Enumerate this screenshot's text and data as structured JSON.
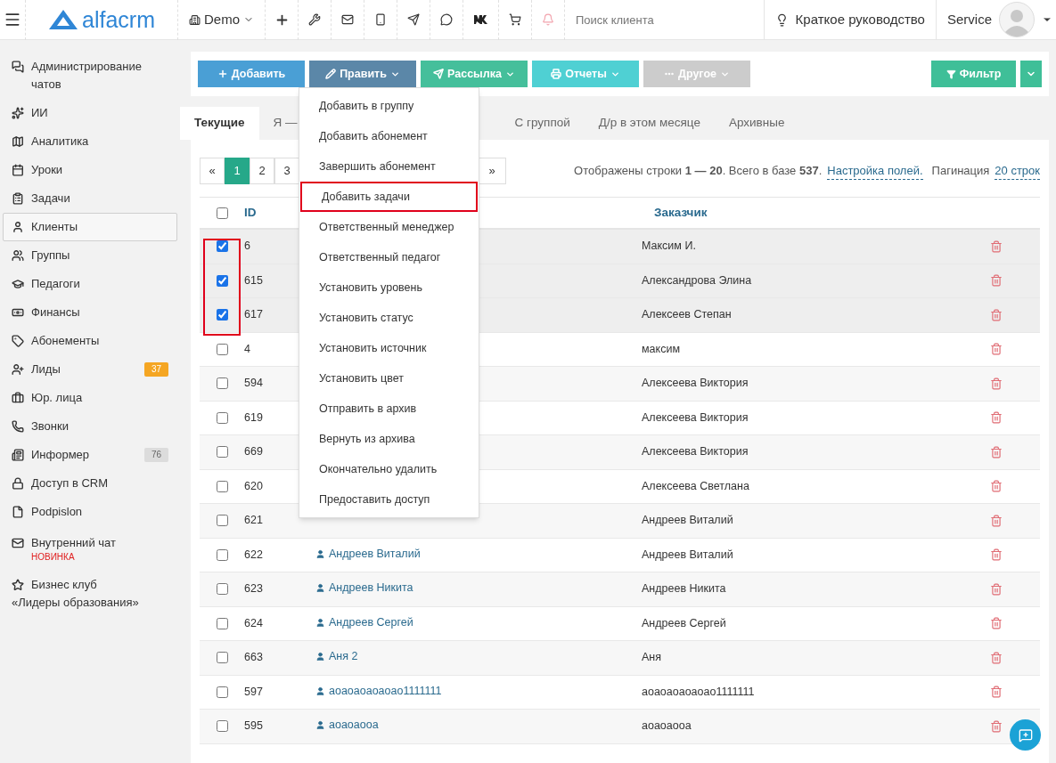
{
  "topbar": {
    "logo": "alfacrm",
    "branch": "Demo",
    "search": {
      "placeholder": "Поиск клиента"
    },
    "guide": "Краткое руководство",
    "user": "Service"
  },
  "sidebar": {
    "items": [
      {
        "label": "Администрирование чатов",
        "selected": false
      },
      {
        "label": "ИИ",
        "selected": false
      },
      {
        "label": "Аналитика",
        "selected": false
      },
      {
        "label": "Уроки",
        "selected": false
      },
      {
        "label": "Задачи",
        "selected": false
      },
      {
        "label": "Клиенты",
        "selected": true
      },
      {
        "label": "Группы",
        "selected": false
      },
      {
        "label": "Педагоги",
        "selected": false
      },
      {
        "label": "Финансы",
        "selected": false
      },
      {
        "label": "Абонементы",
        "selected": false
      },
      {
        "label": "Лиды",
        "selected": false,
        "badge": {
          "text": "37",
          "color": "#f5a623"
        }
      },
      {
        "label": "Юр. лица",
        "selected": false
      },
      {
        "label": "Звонки",
        "selected": false
      },
      {
        "label": "Информер",
        "selected": false,
        "badge": {
          "text": "76",
          "color": "#dcdcdc"
        }
      },
      {
        "label": "Доступ в CRM",
        "selected": false
      },
      {
        "label": "Podpislon",
        "selected": false
      },
      {
        "label": "Внутренний чат",
        "selected": false,
        "note": "НОВИНКА"
      },
      {
        "label": "Бизнес клуб",
        "label_2": "«Лидеры образования»",
        "selected": false
      }
    ]
  },
  "toolbar": {
    "buttons": [
      {
        "label": "Добавить",
        "color": "#4a9fd5"
      },
      {
        "label": "Править",
        "color": "#5b87a8"
      },
      {
        "label": "Рассылка",
        "color": "#45bf9b"
      },
      {
        "label": "Отчеты",
        "color": "#4fd0d3"
      },
      {
        "label": "Другое",
        "color": "#cccccc"
      }
    ],
    "filter": "Фильтр"
  },
  "tabs": [
    {
      "label": "Текущие",
      "selected": true
    },
    {
      "label": "Я —",
      "selected": false
    },
    {
      "label": "С группой",
      "selected": false
    },
    {
      "label": "Д/р в этом месяце",
      "selected": false
    },
    {
      "label": "Архивные",
      "selected": false
    }
  ],
  "pagination": {
    "pages": [
      {
        "label": "«",
        "selected": false
      },
      {
        "label": "1",
        "selected": true
      },
      {
        "label": "2",
        "selected": false
      },
      {
        "label": "3",
        "selected": false
      }
    ],
    "next": "»"
  },
  "summary": {
    "info": "Отображены строки **1 — 20**. Всего в базе **537**.",
    "fields_link": "Настройка полей.",
    "page_size_label": "Пагинация",
    "page_size_link": "20 строк"
  },
  "table": {
    "all_selected": false,
    "columns": [
      "ID",
      "Заказчик"
    ],
    "rows": [
      {
        "id": "6",
        "customer": "Максим И.",
        "selected": true
      },
      {
        "id": "615",
        "customer": "Александрова Элина",
        "selected": true
      },
      {
        "id": "617",
        "customer": "Алексеев Степан",
        "selected": true
      },
      {
        "id": "4",
        "customer": "максим",
        "selected": false
      },
      {
        "id": "594",
        "customer": "Алексеева Виктория",
        "selected": false
      },
      {
        "id": "619",
        "customer": "Алексеева Виктория",
        "selected": false
      },
      {
        "id": "669",
        "customer": "Алексеева Виктория",
        "selected": false
      },
      {
        "id": "620",
        "customer": "Алексеева Светлана",
        "selected": false
      },
      {
        "id": "621",
        "customer": "Андреев Виталий",
        "selected": false
      },
      {
        "id": "622",
        "name": "Андреев Виталий",
        "customer": "Андреев Виталий",
        "selected": false
      },
      {
        "id": "623",
        "name": "Андреев Никита",
        "customer": "Андреев Никита",
        "selected": false
      },
      {
        "id": "624",
        "name": "Андреев Сергей",
        "customer": "Андреев Сергей",
        "selected": false
      },
      {
        "id": "663",
        "name": "Аня 2",
        "customer": "Аня",
        "selected": false
      },
      {
        "id": "597",
        "name": "аоаоаоаоаоао1111111",
        "customer": "аоаоаоаоаоао1111111",
        "selected": false
      },
      {
        "id": "595",
        "name": "аоаоаооа",
        "customer": "аоаоаооа",
        "selected": false
      }
    ]
  },
  "menu": {
    "items": [
      {
        "label": "Добавить в группу",
        "highlighted": false
      },
      {
        "label": "Добавить абонемент",
        "highlighted": false
      },
      {
        "label": "Завершить абонемент",
        "highlighted": false
      },
      {
        "label": "Добавить задачи",
        "highlighted": true
      },
      {
        "label": "Ответственный менеджер",
        "highlighted": false
      },
      {
        "label": "Ответственный педагог",
        "highlighted": false
      },
      {
        "label": "Установить уровень",
        "highlighted": false
      },
      {
        "label": "Установить статус",
        "highlighted": false
      },
      {
        "label": "Установить источник",
        "highlighted": false
      },
      {
        "label": "Установить цвет",
        "highlighted": false
      },
      {
        "label": "Отправить в архив",
        "highlighted": false
      },
      {
        "label": "Вернуть из архива",
        "highlighted": false
      },
      {
        "label": "Окончательно удалить",
        "highlighted": false
      },
      {
        "label": "Предоставить доступ",
        "highlighted": false
      }
    ]
  }
}
